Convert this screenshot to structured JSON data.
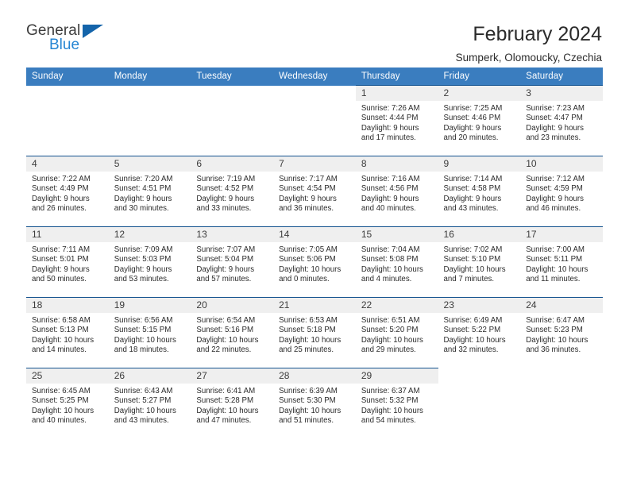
{
  "brand": {
    "name_part1": "General",
    "name_part2": "Blue",
    "triangle_color": "#1464aa",
    "blue_color": "#2585d3"
  },
  "header": {
    "title": "February 2024",
    "subtitle": "Sumperk, Olomoucky, Czechia"
  },
  "theme": {
    "header_bg": "#3a7dbf",
    "row_divider": "#14538f",
    "daynum_bg": "#efefef",
    "text": "#2b2b2b"
  },
  "calendar": {
    "weekday_headers": [
      "Sunday",
      "Monday",
      "Tuesday",
      "Wednesday",
      "Thursday",
      "Friday",
      "Saturday"
    ],
    "weeks": [
      [
        {
          "day": "",
          "blank": true,
          "outside": true
        },
        {
          "day": "",
          "blank": true,
          "outside": true
        },
        {
          "day": "",
          "blank": true,
          "outside": true
        },
        {
          "day": "",
          "blank": true,
          "outside": true
        },
        {
          "day": "1",
          "sunrise": "Sunrise: 7:26 AM",
          "sunset": "Sunset: 4:44 PM",
          "daylight": "Daylight: 9 hours and 17 minutes."
        },
        {
          "day": "2",
          "sunrise": "Sunrise: 7:25 AM",
          "sunset": "Sunset: 4:46 PM",
          "daylight": "Daylight: 9 hours and 20 minutes."
        },
        {
          "day": "3",
          "sunrise": "Sunrise: 7:23 AM",
          "sunset": "Sunset: 4:47 PM",
          "daylight": "Daylight: 9 hours and 23 minutes."
        }
      ],
      [
        {
          "day": "4",
          "sunrise": "Sunrise: 7:22 AM",
          "sunset": "Sunset: 4:49 PM",
          "daylight": "Daylight: 9 hours and 26 minutes."
        },
        {
          "day": "5",
          "sunrise": "Sunrise: 7:20 AM",
          "sunset": "Sunset: 4:51 PM",
          "daylight": "Daylight: 9 hours and 30 minutes."
        },
        {
          "day": "6",
          "sunrise": "Sunrise: 7:19 AM",
          "sunset": "Sunset: 4:52 PM",
          "daylight": "Daylight: 9 hours and 33 minutes."
        },
        {
          "day": "7",
          "sunrise": "Sunrise: 7:17 AM",
          "sunset": "Sunset: 4:54 PM",
          "daylight": "Daylight: 9 hours and 36 minutes."
        },
        {
          "day": "8",
          "sunrise": "Sunrise: 7:16 AM",
          "sunset": "Sunset: 4:56 PM",
          "daylight": "Daylight: 9 hours and 40 minutes."
        },
        {
          "day": "9",
          "sunrise": "Sunrise: 7:14 AM",
          "sunset": "Sunset: 4:58 PM",
          "daylight": "Daylight: 9 hours and 43 minutes."
        },
        {
          "day": "10",
          "sunrise": "Sunrise: 7:12 AM",
          "sunset": "Sunset: 4:59 PM",
          "daylight": "Daylight: 9 hours and 46 minutes."
        }
      ],
      [
        {
          "day": "11",
          "sunrise": "Sunrise: 7:11 AM",
          "sunset": "Sunset: 5:01 PM",
          "daylight": "Daylight: 9 hours and 50 minutes."
        },
        {
          "day": "12",
          "sunrise": "Sunrise: 7:09 AM",
          "sunset": "Sunset: 5:03 PM",
          "daylight": "Daylight: 9 hours and 53 minutes."
        },
        {
          "day": "13",
          "sunrise": "Sunrise: 7:07 AM",
          "sunset": "Sunset: 5:04 PM",
          "daylight": "Daylight: 9 hours and 57 minutes."
        },
        {
          "day": "14",
          "sunrise": "Sunrise: 7:05 AM",
          "sunset": "Sunset: 5:06 PM",
          "daylight": "Daylight: 10 hours and 0 minutes."
        },
        {
          "day": "15",
          "sunrise": "Sunrise: 7:04 AM",
          "sunset": "Sunset: 5:08 PM",
          "daylight": "Daylight: 10 hours and 4 minutes."
        },
        {
          "day": "16",
          "sunrise": "Sunrise: 7:02 AM",
          "sunset": "Sunset: 5:10 PM",
          "daylight": "Daylight: 10 hours and 7 minutes."
        },
        {
          "day": "17",
          "sunrise": "Sunrise: 7:00 AM",
          "sunset": "Sunset: 5:11 PM",
          "daylight": "Daylight: 10 hours and 11 minutes."
        }
      ],
      [
        {
          "day": "18",
          "sunrise": "Sunrise: 6:58 AM",
          "sunset": "Sunset: 5:13 PM",
          "daylight": "Daylight: 10 hours and 14 minutes."
        },
        {
          "day": "19",
          "sunrise": "Sunrise: 6:56 AM",
          "sunset": "Sunset: 5:15 PM",
          "daylight": "Daylight: 10 hours and 18 minutes."
        },
        {
          "day": "20",
          "sunrise": "Sunrise: 6:54 AM",
          "sunset": "Sunset: 5:16 PM",
          "daylight": "Daylight: 10 hours and 22 minutes."
        },
        {
          "day": "21",
          "sunrise": "Sunrise: 6:53 AM",
          "sunset": "Sunset: 5:18 PM",
          "daylight": "Daylight: 10 hours and 25 minutes."
        },
        {
          "day": "22",
          "sunrise": "Sunrise: 6:51 AM",
          "sunset": "Sunset: 5:20 PM",
          "daylight": "Daylight: 10 hours and 29 minutes."
        },
        {
          "day": "23",
          "sunrise": "Sunrise: 6:49 AM",
          "sunset": "Sunset: 5:22 PM",
          "daylight": "Daylight: 10 hours and 32 minutes."
        },
        {
          "day": "24",
          "sunrise": "Sunrise: 6:47 AM",
          "sunset": "Sunset: 5:23 PM",
          "daylight": "Daylight: 10 hours and 36 minutes."
        }
      ],
      [
        {
          "day": "25",
          "sunrise": "Sunrise: 6:45 AM",
          "sunset": "Sunset: 5:25 PM",
          "daylight": "Daylight: 10 hours and 40 minutes."
        },
        {
          "day": "26",
          "sunrise": "Sunrise: 6:43 AM",
          "sunset": "Sunset: 5:27 PM",
          "daylight": "Daylight: 10 hours and 43 minutes."
        },
        {
          "day": "27",
          "sunrise": "Sunrise: 6:41 AM",
          "sunset": "Sunset: 5:28 PM",
          "daylight": "Daylight: 10 hours and 47 minutes."
        },
        {
          "day": "28",
          "sunrise": "Sunrise: 6:39 AM",
          "sunset": "Sunset: 5:30 PM",
          "daylight": "Daylight: 10 hours and 51 minutes."
        },
        {
          "day": "29",
          "sunrise": "Sunrise: 6:37 AM",
          "sunset": "Sunset: 5:32 PM",
          "daylight": "Daylight: 10 hours and 54 minutes."
        },
        {
          "day": "",
          "blank": true,
          "outside": true
        },
        {
          "day": "",
          "blank": true,
          "outside": true
        }
      ]
    ]
  }
}
